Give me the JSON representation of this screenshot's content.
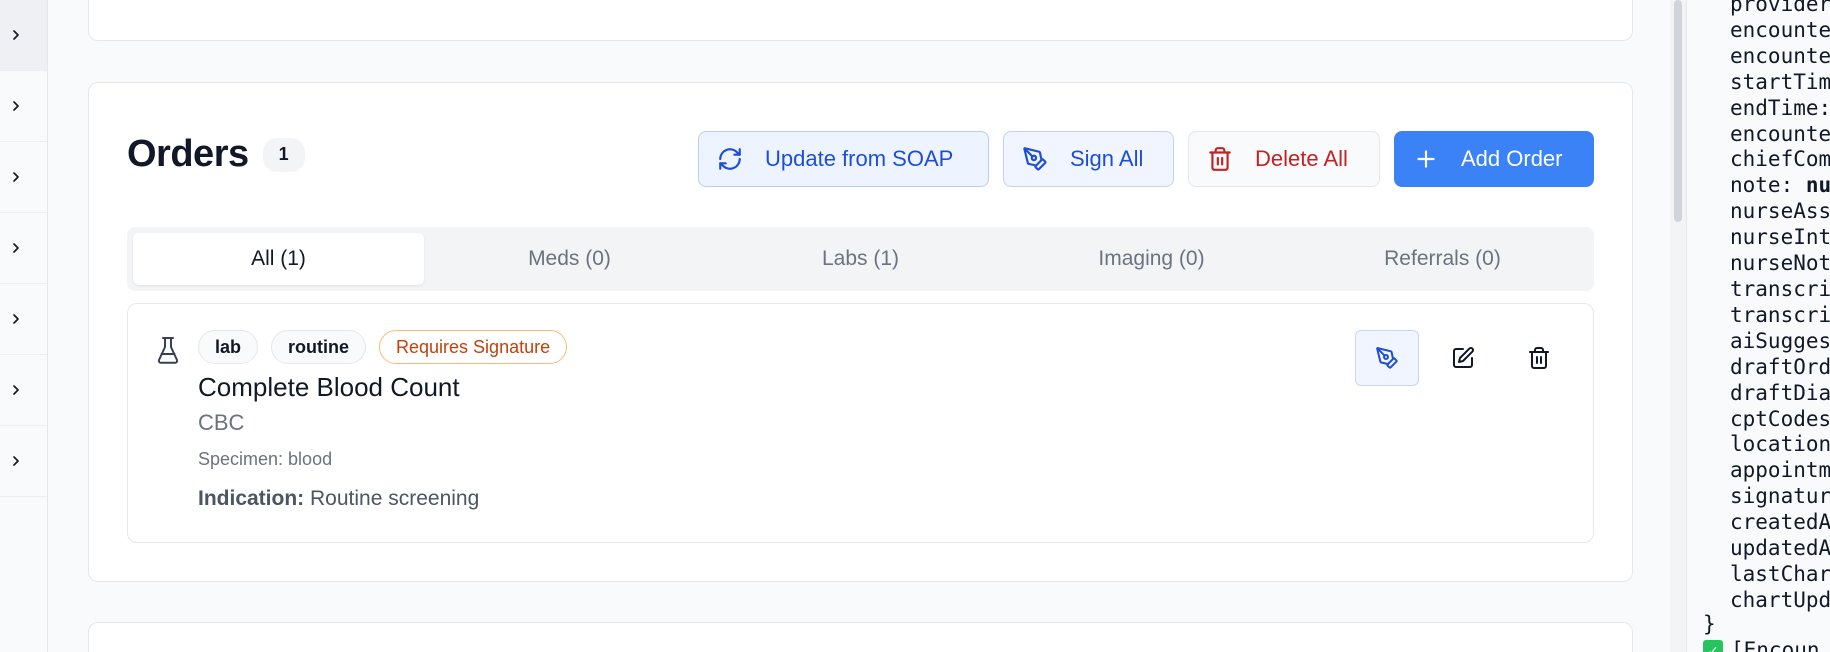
{
  "orders": {
    "title": "Orders",
    "count": "1",
    "buttons": {
      "update_from_soap": "Update from SOAP",
      "sign_all": "Sign All",
      "delete_all": "Delete All",
      "add_order": "Add Order"
    },
    "tabs": [
      {
        "label": "All (1)",
        "active": true
      },
      {
        "label": "Meds (0)",
        "active": false
      },
      {
        "label": "Labs (1)",
        "active": false
      },
      {
        "label": "Imaging (0)",
        "active": false
      },
      {
        "label": "Referrals (0)",
        "active": false
      }
    ],
    "items": [
      {
        "type_icon": "flask-icon",
        "chips": [
          "lab",
          "routine"
        ],
        "status": "Requires Signature",
        "name": "Complete Blood Count",
        "code": "CBC",
        "specimen": "Specimen: blood",
        "indication_label": "Indication:",
        "indication_value": "Routine screening"
      }
    ]
  },
  "sidebar_rail": {
    "icons": [
      "chevron-right-icon",
      "chevron-right-icon",
      "chevron-right-icon",
      "chevron-right-icon",
      "chevron-right-icon",
      "chevron-right-icon",
      "chevron-right-icon"
    ]
  },
  "debug_panel": {
    "lines": [
      {
        "text": "provider",
        "bold": false
      },
      {
        "text": "encounte",
        "bold": false
      },
      {
        "text": "encounte",
        "bold": false
      },
      {
        "text": "startTim",
        "bold": false
      },
      {
        "text": "endTime:",
        "bold": false
      },
      {
        "text": "encounte",
        "bold": false
      },
      {
        "text": "chiefCom",
        "bold": false
      },
      {
        "text": "note: nu",
        "bold": false
      },
      {
        "text": "nurseAss",
        "bold": false
      },
      {
        "text": "nurseInt",
        "bold": false
      },
      {
        "text": "nurseNot",
        "bold": false
      },
      {
        "text": "transcri",
        "bold": false
      },
      {
        "text": "transcri",
        "bold": false
      },
      {
        "text": "aiSugges",
        "bold": false
      },
      {
        "text": "draftOrd",
        "bold": false
      },
      {
        "text": "draftDia",
        "bold": false
      },
      {
        "text": "cptCodes",
        "bold": false
      },
      {
        "text": "location",
        "bold": false
      },
      {
        "text": "appointm",
        "bold": false
      },
      {
        "text": "signatur",
        "bold": false
      },
      {
        "text": "createdA",
        "bold": false
      },
      {
        "text": "updatedA",
        "bold": false
      },
      {
        "text": "lastChar",
        "bold": false
      },
      {
        "text": "chartUpd",
        "bold": false
      }
    ],
    "closing_brace": "}",
    "log_text": "[Encoun"
  },
  "colors": {
    "primary": "#3b82f6",
    "sign_blue": "#1d4ed8",
    "danger": "#c02424",
    "warning": "#c2410c",
    "success": "#22c55e"
  }
}
